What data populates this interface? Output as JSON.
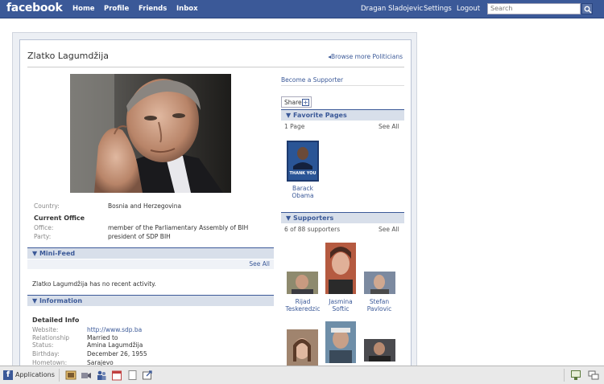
{
  "topbar": {
    "logo": "facebook",
    "nav": [
      "Home",
      "Profile",
      "Friends",
      "Inbox"
    ],
    "user": "Dragan Sladojevic",
    "settings": "Settings",
    "logout": "Logout",
    "search_placeholder": "Search"
  },
  "profile": {
    "name": "Zlatko Lagumdžija",
    "browse": "Browse more Politicians",
    "country_label": "Country:",
    "country": "Bosnia and Herzegovina",
    "current_office_title": "Current Office",
    "office_label": "Office:",
    "office": "member of the Parliamentary Assembly of BIH",
    "party_label": "Party:",
    "party": "president of SDP BIH"
  },
  "minifeed": {
    "title": "Mini-Feed",
    "see_all": "See All",
    "text": "Zlatko Lagumdžija has no recent activity."
  },
  "information": {
    "title": "Information",
    "detailed_title": "Detailed Info",
    "website_label": "Website:",
    "website": "http://www.sdp.ba",
    "relationship_label_1": "Relationship",
    "relationship_label_2": "Status:",
    "relationship_value_1": "Married to",
    "relationship_value_2": "Amina Lagumdžija",
    "birthday_label": "Birthday:",
    "birthday": "December 26, 1955",
    "hometown_label": "Hometown:",
    "hometown": "Sarajevo"
  },
  "sidebar": {
    "become_supporter": "Become a Supporter",
    "share": "Share",
    "favorite_pages_title": "Favorite Pages",
    "favorite_pages_count": "1 Page",
    "see_all": "See All",
    "favorite_page_name_1": "Barack",
    "favorite_page_name_2": "Obama",
    "thank_you": "THANK YOU",
    "supporters_title": "Supporters",
    "supporters_count": "6 of 88 supporters",
    "supporters": [
      {
        "first": "Rijad",
        "last": "Teskeredzic"
      },
      {
        "first": "Jasmina",
        "last": "Softic"
      },
      {
        "first": "Stefan",
        "last": "Pavlovic"
      }
    ]
  },
  "bottombar": {
    "applications": "Applications"
  },
  "colors": {
    "brand": "#3b5998",
    "section_bar": "#d8dfea"
  }
}
